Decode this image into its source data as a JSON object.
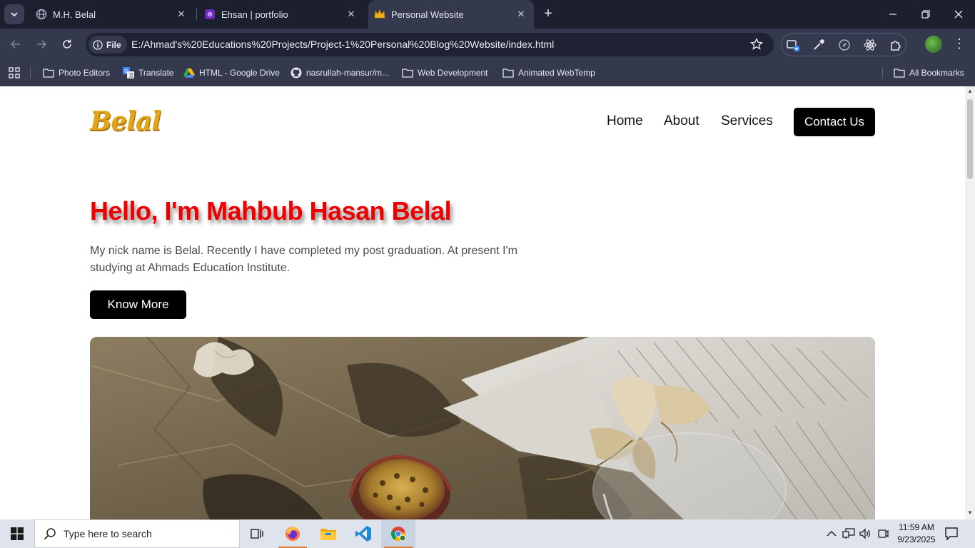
{
  "browser": {
    "tabs": [
      {
        "title": "M.H. Belal",
        "active": false
      },
      {
        "title": "Ehsan | portfolio",
        "active": false
      },
      {
        "title": "Personal Website",
        "active": true
      }
    ],
    "address": {
      "chip_label": "File",
      "url": "E:/Ahmad's%20Educations%20Projects/Project-1%20Personal%20Blog%20Website/index.html"
    },
    "bookmarks": [
      {
        "label": "Photo Editors",
        "icon": "folder-icon"
      },
      {
        "label": "Translate",
        "icon": "translate-icon"
      },
      {
        "label": "HTML - Google Drive",
        "icon": "google-drive-icon"
      },
      {
        "label": "nasrullah-mansur/m...",
        "icon": "github-icon"
      },
      {
        "label": "Web Development",
        "icon": "folder-icon"
      },
      {
        "label": "Animated WebTemp",
        "icon": "folder-icon"
      }
    ],
    "all_bookmarks_label": "All Bookmarks"
  },
  "page": {
    "logo": "Belal",
    "nav": {
      "home": "Home",
      "about": "About",
      "services": "Services",
      "contact": "Contact Us"
    },
    "hero": {
      "title": "Hello, I'm Mahbub Hasan Belal",
      "text": "My nick name is Belal. Recently I have completed my post graduation. At present I'm studying at Ahmads Education Institute.",
      "button": "Know More",
      "image_alt": "Still life photo of dried flowers, a passion fruit and an open book on crumpled paper"
    },
    "colors": {
      "title": "#ee0000",
      "logo": "#e2a51a",
      "button_bg": "#000000"
    }
  },
  "taskbar": {
    "search_placeholder": "Type here to search",
    "time": "11:59 AM",
    "date": "9/23/2025",
    "apps": [
      "task-view-icon",
      "firefox-icon",
      "file-explorer-icon",
      "vscode-icon",
      "chrome-icon"
    ]
  }
}
